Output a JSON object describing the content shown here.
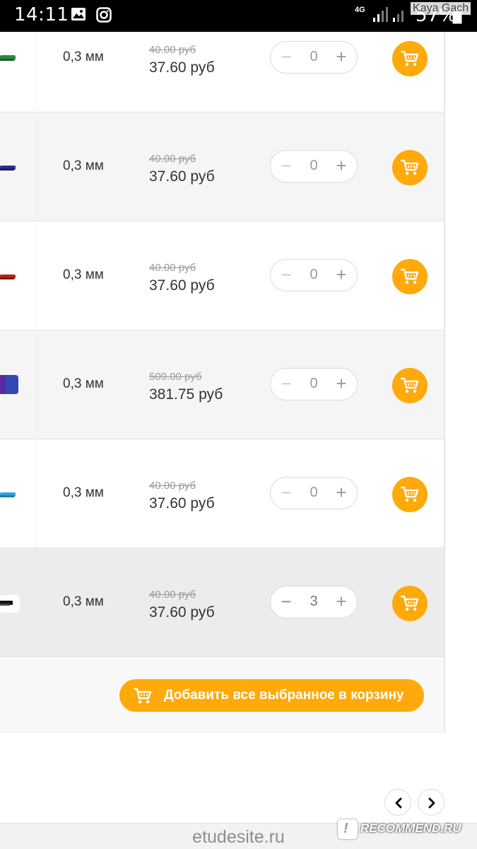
{
  "status_bar": {
    "time": "14:11",
    "network": "4G",
    "battery": "57%",
    "watermark": "Kaya Gach"
  },
  "rows": [
    {
      "thickness": "0,3 мм",
      "old_price": "40.00 руб",
      "price": "37.60 руб",
      "qty": "0",
      "swatch_color": "#2a8a3a"
    },
    {
      "thickness": "0,3 мм",
      "old_price": "40.00 руб",
      "price": "37.60 руб",
      "qty": "0",
      "swatch_color": "#2b2f8f"
    },
    {
      "thickness": "0,3 мм",
      "old_price": "40.00 руб",
      "price": "37.60 руб",
      "qty": "0",
      "swatch_color": "#b3261e"
    },
    {
      "thickness": "0,3 мм",
      "old_price": "509.00 руб",
      "price": "381.75 руб",
      "qty": "0",
      "swatch_color": "#3546b5"
    },
    {
      "thickness": "0,3 мм",
      "old_price": "40.00 руб",
      "price": "37.60 руб",
      "qty": "0",
      "swatch_color": "#2aa6e0"
    },
    {
      "thickness": "0,3 мм",
      "old_price": "40.00 руб",
      "price": "37.60 руб",
      "qty": "3",
      "swatch_color": "#111111"
    }
  ],
  "stepper": {
    "minus": "−",
    "plus": "+"
  },
  "add_all_label": "Добавить все выбранное в корзину",
  "pagination": {
    "prev": "prev",
    "next": "next"
  },
  "footer": {
    "site": "etudesite.ru",
    "badge": "RECOMMEND.RU"
  },
  "colors": {
    "accent": "#ffa90a"
  }
}
